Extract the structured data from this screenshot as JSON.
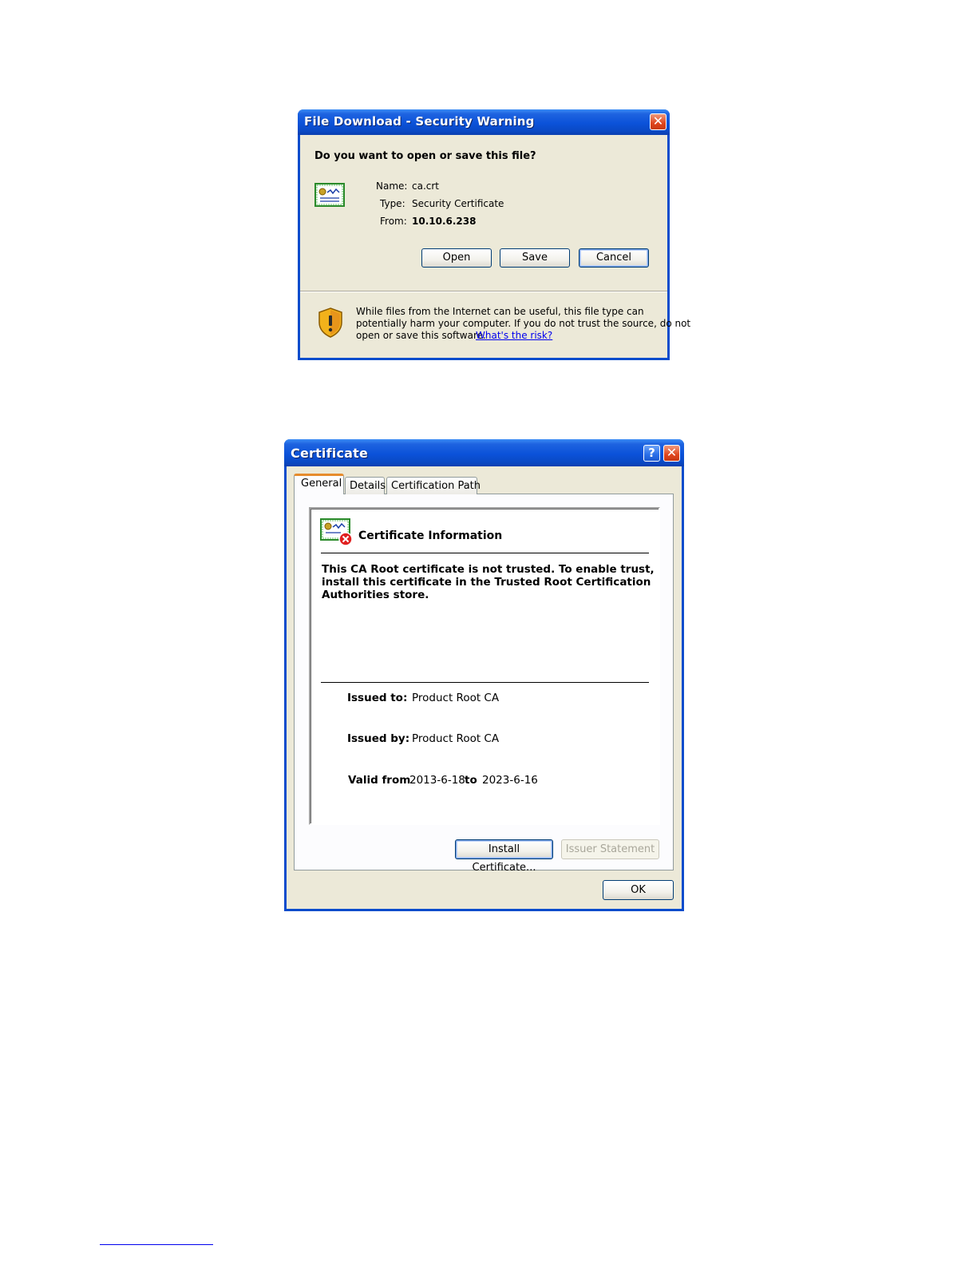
{
  "file_download": {
    "title": "File Download - Security Warning",
    "question": "Do you want to open or save this file?",
    "name_label": "Name:",
    "name_value": "ca.crt",
    "type_label": "Type:",
    "type_value": "Security Certificate",
    "from_label": "From:",
    "from_value": "10.10.6.238",
    "open_label": "Open",
    "save_label": "Save",
    "cancel_label": "Cancel",
    "warning_line1": "While files from the Internet can be useful, this file type can",
    "warning_line2": "potentially harm your computer. If you do not trust the source, do not",
    "warning_line3": "open or save this software.",
    "risk_link": "What's the risk?",
    "close_glyph": "✕"
  },
  "certificate": {
    "title": "Certificate",
    "help_glyph": "?",
    "close_glyph": "✕",
    "tabs": [
      "General",
      "Details",
      "Certification Path"
    ],
    "info_heading": "Certificate Information",
    "message_line1": "This CA Root certificate is not trusted. To enable trust,",
    "message_line2": "install this certificate in the Trusted Root Certification",
    "message_line3": "Authorities store.",
    "issued_to_label": "Issued to:",
    "issued_to_value": "Product Root CA",
    "issued_by_label": "Issued by:",
    "issued_by_value": "Product Root CA",
    "valid_from_label": "Valid from",
    "valid_from_value": "2013-6-18",
    "valid_to_label": "to",
    "valid_to_value": "2023-6-16",
    "install_label": "Install Certificate...",
    "issuer_statement_label": "Issuer Statement",
    "ok_label": "OK"
  },
  "icons": {
    "certificate": "certificate-icon",
    "certificate_error": "certificate-error-icon",
    "shield_warning": "shield-warning-icon"
  },
  "colors": {
    "title_bar": "#0b52d9",
    "window_face": "#ece9d8",
    "close_button": "#e0451d",
    "link": "#0000ee"
  }
}
